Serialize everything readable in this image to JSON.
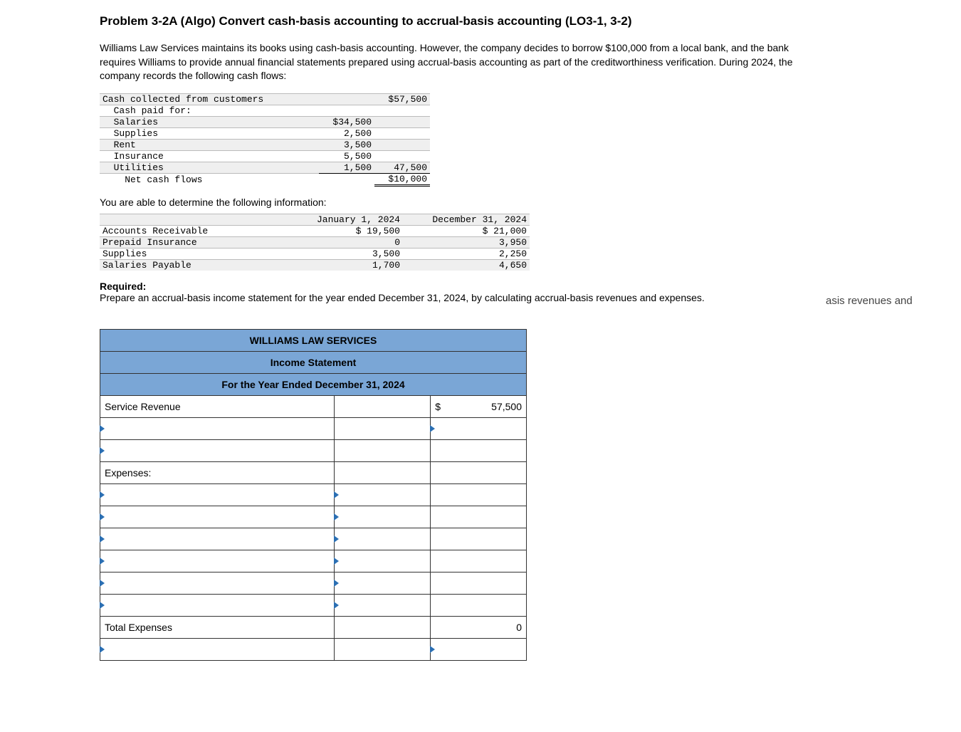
{
  "title": "Problem 3-2A (Algo) Convert cash-basis accounting to accrual-basis accounting (LO3-1, 3-2)",
  "intro": "Williams Law Services maintains its books using cash-basis accounting. However, the company decides to borrow $100,000 from a local bank, and the bank requires Williams to provide annual financial statements prepared using accrual-basis accounting as part of the creditworthiness verification. During 2024, the company records the following cash flows:",
  "cashflows": {
    "rows": [
      {
        "label": "Cash collected from customers",
        "c1": "",
        "c2": "$57,500"
      },
      {
        "label": "  Cash paid for:",
        "c1": "",
        "c2": ""
      },
      {
        "label": "  Salaries",
        "c1": "$34,500",
        "c2": ""
      },
      {
        "label": "  Supplies",
        "c1": "2,500",
        "c2": ""
      },
      {
        "label": "  Rent",
        "c1": "3,500",
        "c2": ""
      },
      {
        "label": "  Insurance",
        "c1": "5,500",
        "c2": ""
      },
      {
        "label": "  Utilities",
        "c1": "1,500",
        "c2": "47,500"
      },
      {
        "label": "    Net cash flows",
        "c1": "",
        "c2": "$10,000"
      }
    ]
  },
  "balances_intro": "You are able to determine the following information:",
  "balances": {
    "headers": {
      "c1": "January 1, 2024",
      "c2": "December 31, 2024"
    },
    "rows": [
      {
        "label": "Accounts Receivable",
        "c1": "$ 19,500",
        "c2": "$ 21,000"
      },
      {
        "label": "Prepaid Insurance",
        "c1": "0",
        "c2": "3,950"
      },
      {
        "label": "Supplies",
        "c1": "3,500",
        "c2": "2,250"
      },
      {
        "label": "Salaries Payable",
        "c1": "1,700",
        "c2": "4,650"
      }
    ]
  },
  "required": {
    "label": "Required:",
    "text": "Prepare an accrual-basis income statement for the year ended December 31, 2024, by calculating accrual-basis revenues and expenses."
  },
  "floating_fragment": "asis revenues and",
  "income_statement": {
    "h1": "WILLIAMS LAW SERVICES",
    "h2": "Income Statement",
    "h3": "For the Year Ended December 31, 2024",
    "rows": {
      "service_revenue_label": "Service Revenue",
      "service_revenue_sym": "$",
      "service_revenue_amt": "57,500",
      "expenses_label": "Expenses:",
      "total_expenses_label": "Total Expenses",
      "total_expenses_amt": "0"
    }
  }
}
